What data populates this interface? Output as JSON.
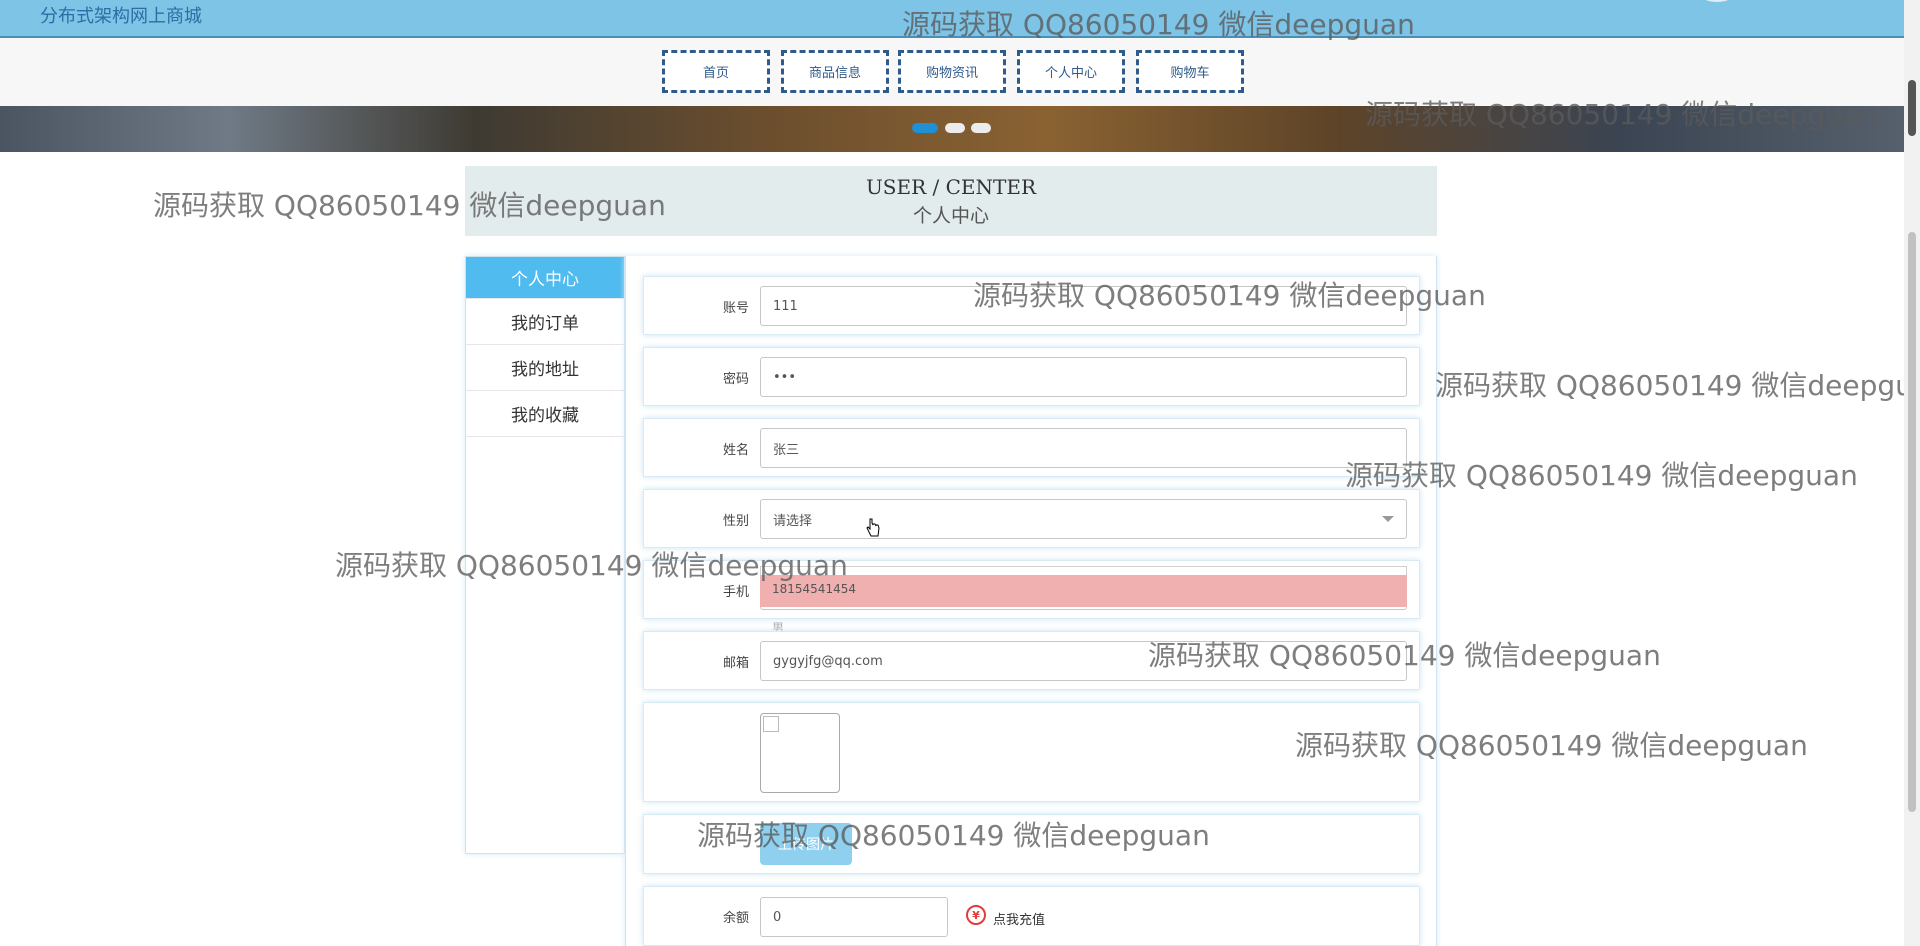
{
  "site_title": "分布式架构网上商城",
  "nav": {
    "items": [
      {
        "label": "首页"
      },
      {
        "label": "商品信息"
      },
      {
        "label": "购物资讯"
      },
      {
        "label": "个人中心"
      },
      {
        "label": "购物车"
      }
    ]
  },
  "section_header": {
    "en": "USER / CENTER",
    "cn": "个人中心"
  },
  "sidebar": {
    "items": [
      {
        "label": "个人中心",
        "active": true
      },
      {
        "label": "我的订单"
      },
      {
        "label": "我的地址"
      },
      {
        "label": "我的收藏"
      }
    ]
  },
  "form": {
    "account": {
      "label": "账号",
      "value": "111"
    },
    "password": {
      "label": "密码",
      "value": "•••"
    },
    "name": {
      "label": "姓名",
      "value": "张三"
    },
    "gender": {
      "label": "性别",
      "placeholder": "请选择",
      "options": [
        "",
        "男"
      ]
    },
    "phone": {
      "label": "手机",
      "value": "18154541454"
    },
    "email": {
      "label": "邮箱",
      "value": "gygyjfg@qq.com"
    },
    "upload_label": "上传图片",
    "balance": {
      "label": "余额",
      "value": "0"
    },
    "recharge_label": "点我充值",
    "recharge_icon": "¥"
  },
  "watermark_text": "源码获取 QQ86050149 微信deepguan",
  "colors": {
    "topbar": "#7ec4e6",
    "nav_border": "#2e5b8a",
    "sidebar_active": "#4fbbee",
    "highlight_option": "#f0b0b0",
    "upload_button": "#8fd0ef"
  }
}
